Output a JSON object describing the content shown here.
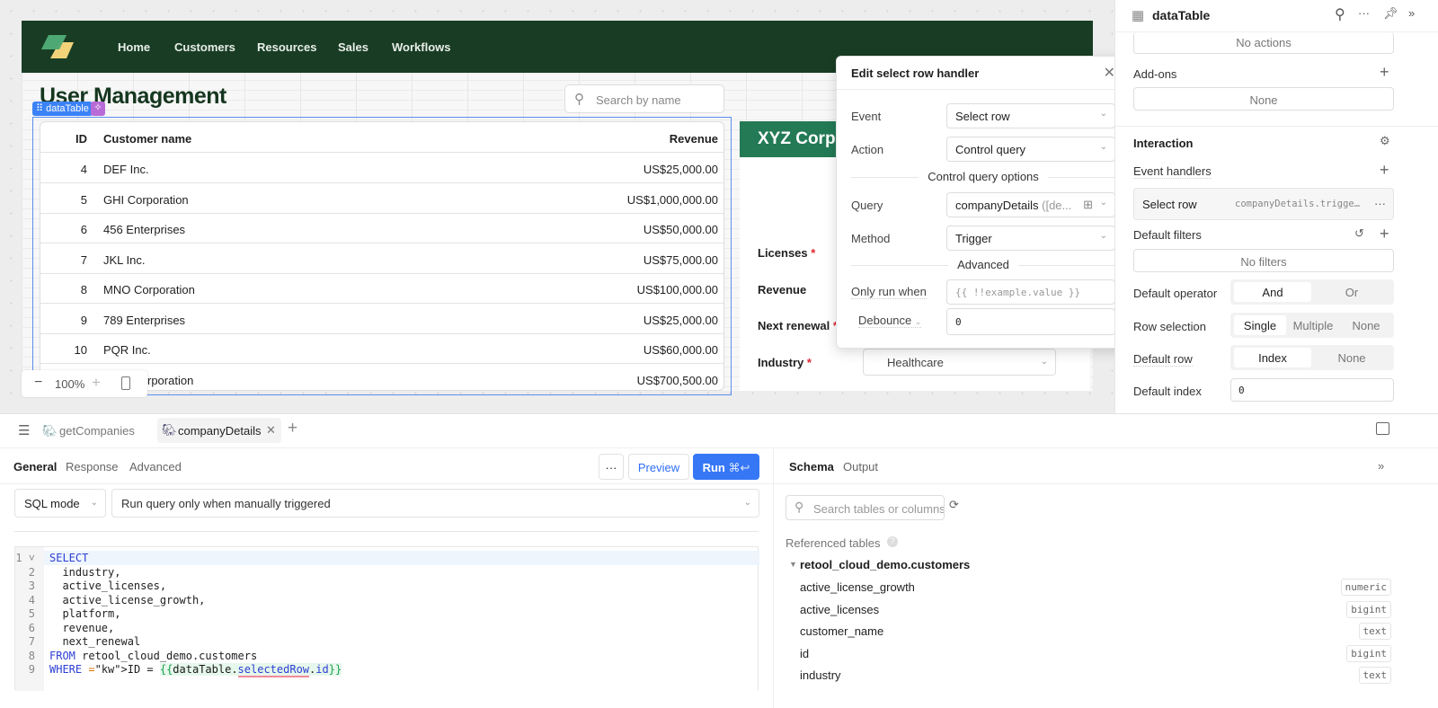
{
  "nav": {
    "items": [
      "Home",
      "Customers",
      "Resources",
      "Sales",
      "Workflows"
    ]
  },
  "page": {
    "title": "User Management",
    "search_placeholder": "Search by name"
  },
  "table": {
    "badge": "dataTable",
    "columns": [
      "ID",
      "Customer name",
      "Revenue"
    ],
    "rows": [
      {
        "id": "4",
        "name": "DEF Inc.",
        "revenue": "US$25,000.00"
      },
      {
        "id": "5",
        "name": "GHI Corporation",
        "revenue": "US$1,000,000.00"
      },
      {
        "id": "6",
        "name": "456 Enterprises",
        "revenue": "US$50,000.00"
      },
      {
        "id": "7",
        "name": "JKL Inc.",
        "revenue": "US$75,000.00"
      },
      {
        "id": "8",
        "name": "MNO Corporation",
        "revenue": "US$100,000.00"
      },
      {
        "id": "9",
        "name": "789 Enterprises",
        "revenue": "US$25,000.00"
      },
      {
        "id": "10",
        "name": "PQR Inc.",
        "revenue": "US$60,000.00"
      },
      {
        "id": "",
        "name": "rporation",
        "revenue": "US$700,500.00"
      }
    ]
  },
  "card": {
    "title": "XYZ Corp",
    "fields": [
      "Licenses",
      "Revenue",
      "Next renewal",
      "Industry"
    ],
    "industry_value": "Healthcare"
  },
  "zoom": {
    "level": "100%"
  },
  "popup": {
    "title": "Edit select row handler",
    "event_label": "Event",
    "event_value": "Select row",
    "action_label": "Action",
    "action_value": "Control query",
    "section1": "Control query options",
    "query_label": "Query",
    "query_value": "companyDetails",
    "query_hint": "([de...",
    "method_label": "Method",
    "method_value": "Trigger",
    "section2": "Advanced",
    "only_run_label": "Only run when",
    "only_run_placeholder": "{{ !!example.value }}",
    "debounce_label": "Debounce",
    "debounce_value": "0"
  },
  "inspector": {
    "title": "dataTable",
    "no_actions": "No actions",
    "addons_label": "Add-ons",
    "addons_value": "None",
    "interaction": "Interaction",
    "event_handlers": "Event handlers",
    "handler_event": "Select row",
    "handler_action": "companyDetails.trigge…",
    "default_filters": "Default filters",
    "no_filters": "No filters",
    "default_operator": "Default operator",
    "operator_options": [
      "And",
      "Or"
    ],
    "operator_selected": "And",
    "row_selection": "Row selection",
    "row_selection_options": [
      "Single",
      "Multiple",
      "None"
    ],
    "row_selection_selected": "Single",
    "default_row": "Default row",
    "default_row_options": [
      "Index",
      "None"
    ],
    "default_row_selected": "Index",
    "default_index": "Default index",
    "default_index_value": "0"
  },
  "queries": {
    "tabs": [
      "getCompanies",
      "companyDetails"
    ],
    "active": "companyDetails",
    "subtabs": [
      "General",
      "Response",
      "Advanced"
    ],
    "preview": "Preview",
    "run": "Run",
    "run_shortcut": "⌘↩",
    "mode": "SQL mode",
    "trigger": "Run query only when manually triggered",
    "code": [
      "SELECT",
      "  industry,",
      "  active_licenses,",
      "  active_license_growth,",
      "  platform,",
      "  revenue,",
      "  next_renewal",
      "FROM retool_cloud_demo.customers",
      "WHERE ID = {{dataTable.selectedRow.id}}"
    ]
  },
  "schema": {
    "tabs": [
      "Schema",
      "Output"
    ],
    "search_placeholder": "Search tables or columns",
    "referenced": "Referenced tables",
    "table_name": "retool_cloud_demo.customers",
    "columns": [
      {
        "name": "active_license_growth",
        "type": "numeric"
      },
      {
        "name": "active_licenses",
        "type": "bigint"
      },
      {
        "name": "customer_name",
        "type": "text"
      },
      {
        "name": "id",
        "type": "bigint"
      },
      {
        "name": "industry",
        "type": "text"
      }
    ]
  },
  "colors": {
    "header": "#193d24",
    "card_header": "#237a55",
    "accent": "#3b82f6"
  }
}
